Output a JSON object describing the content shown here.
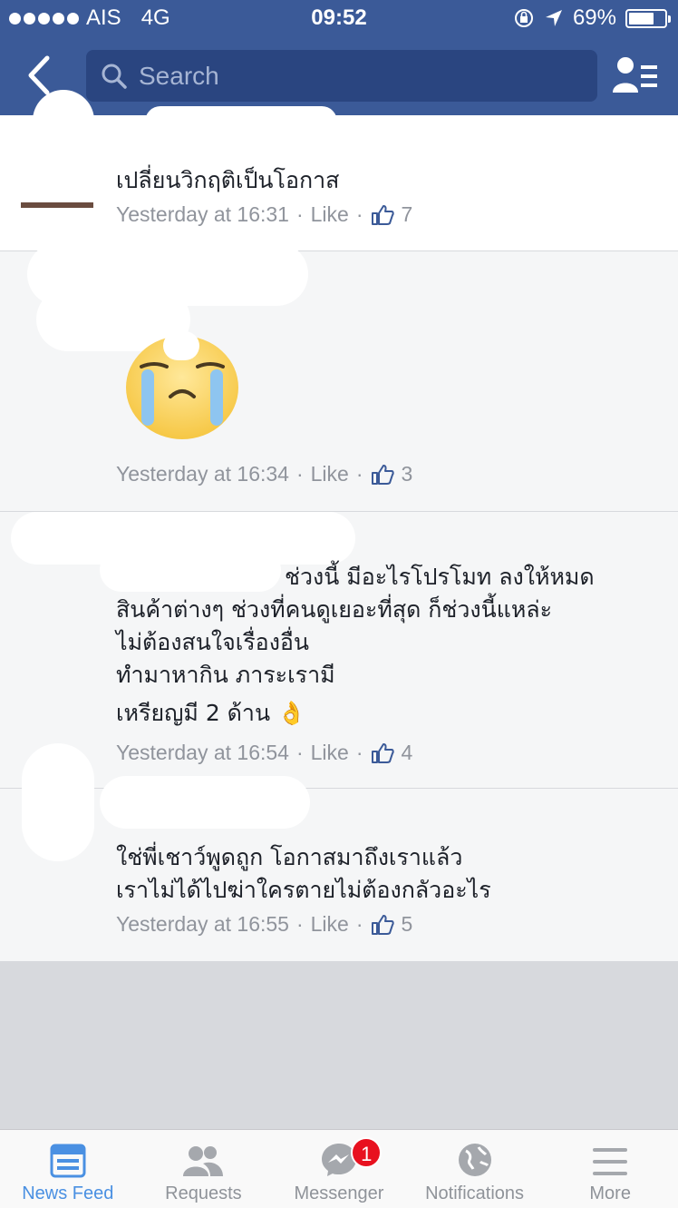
{
  "status_bar": {
    "carrier": "AIS",
    "network": "4G",
    "time": "09:52",
    "battery": "69%",
    "battery_level": 0.69
  },
  "nav": {
    "search_placeholder": "Search"
  },
  "comments": [
    {
      "text": "เปลี่ยนวิกฤติเป็นโอกาส",
      "time": "Yesterday at 16:31",
      "like_label": "Like",
      "likes": "7"
    },
    {
      "text": "",
      "time": "Yesterday at 16:34",
      "like_label": "Like",
      "likes": "3",
      "sticker": "crying-face"
    },
    {
      "text_lines": [
        "ช่วงนี้ มีอะไรโปรโมท ลงให้หมด",
        "สินค้าต่างๆ ช่วงที่คนดูเยอะที่สุด ก็ช่วงนี้แหล่ะ",
        " ไม่ต้องสนใจเรื่องอื่น",
        "ทำมาหากิน ภาระเรามี",
        "เหรียญมี 2 ด้าน 👌"
      ],
      "time": "Yesterday at 16:54",
      "like_label": "Like",
      "likes": "4"
    },
    {
      "text_lines": [
        "ใช่พี่เชาว์พูดถูก โอกาสมาถึงเราแล้ว",
        "เราไม่ได้ไปฆ่าใครตายไม่ต้องกลัวอะไร"
      ],
      "time": "Yesterday at 16:55",
      "like_label": "Like",
      "likes": "5"
    }
  ],
  "tabs": [
    {
      "label": "News Feed",
      "icon": "news-feed-icon",
      "active": true
    },
    {
      "label": "Requests",
      "icon": "friends-icon"
    },
    {
      "label": "Messenger",
      "icon": "messenger-icon",
      "badge": "1"
    },
    {
      "label": "Notifications",
      "icon": "globe-icon"
    },
    {
      "label": "More",
      "icon": "menu-icon"
    }
  ],
  "colors": {
    "brand": "#3b5a98",
    "accent": "#4a90e2",
    "badge": "#e8111f"
  }
}
